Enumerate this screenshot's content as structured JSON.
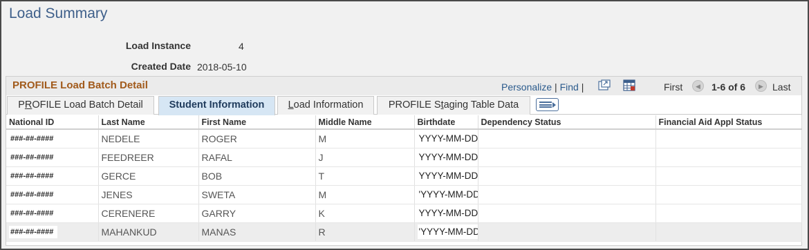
{
  "page": {
    "title": "Load Summary"
  },
  "summary": {
    "load_instance_label": "Load Instance",
    "load_instance_value": "4",
    "created_date_label": "Created Date",
    "created_date_value": "2018-05-10"
  },
  "grid": {
    "title": "PROFILE Load Batch Detail",
    "personalize": "Personalize",
    "sep1": "|",
    "find": "Find",
    "sep2": "|",
    "first": "First",
    "range": "1-6 of 6",
    "last": "Last",
    "icons": {
      "view_all": "zoom-window-icon",
      "download": "download-spreadsheet-icon",
      "prev": "previous-arrow-icon",
      "next": "next-arrow-icon",
      "show_all_columns": "show-all-columns-icon"
    }
  },
  "tabs": [
    {
      "pre": "P",
      "u": "R",
      "post": "OFILE Load Batch Detail"
    },
    {
      "pre": "",
      "u": "",
      "post": "Student Information"
    },
    {
      "pre": "",
      "u": "L",
      "post": "oad Information"
    },
    {
      "pre": "PROFILE S",
      "u": "t",
      "post": "aging Table Data"
    }
  ],
  "table": {
    "columns": [
      "National ID",
      "Last Name",
      "First Name",
      "Middle Name",
      "Birthdate",
      "Dependency Status",
      "Financial Aid Appl Status"
    ],
    "rows": [
      {
        "nid": "###-##-####",
        "last": "NEDELE",
        "first": "ROGER",
        "middle": "M",
        "birth": "YYYY-MM-DD",
        "dep": "",
        "fa": ""
      },
      {
        "nid": "###-##-####",
        "last": "FEEDREER",
        "first": "RAFAL",
        "middle": "J",
        "birth": "YYYY-MM-DD",
        "dep": "",
        "fa": ""
      },
      {
        "nid": "###-##-####",
        "last": "GERCE",
        "first": "BOB",
        "middle": "T",
        "birth": "YYYY-MM-DD",
        "dep": "",
        "fa": ""
      },
      {
        "nid": "###-##-####",
        "last": "JENES",
        "first": "SWETA",
        "middle": "M",
        "birth": "'YYYY-MM-DD",
        "dep": "",
        "fa": ""
      },
      {
        "nid": "###-##-####",
        "last": "CERENERE",
        "first": "GARRY",
        "middle": "K",
        "birth": "YYYY-MM-DD",
        "dep": "",
        "fa": ""
      },
      {
        "nid": "###-##-####",
        "last": "MAHANKUD",
        "first": "MANAS",
        "middle": "R",
        "birth": "'YYYY-MM-DD",
        "dep": "",
        "fa": ""
      }
    ]
  },
  "colors": {
    "title": "#3e5f8a",
    "grid_title": "#a15a1b",
    "link": "#2a5a8c",
    "active_tab": "#d6e6f4"
  }
}
